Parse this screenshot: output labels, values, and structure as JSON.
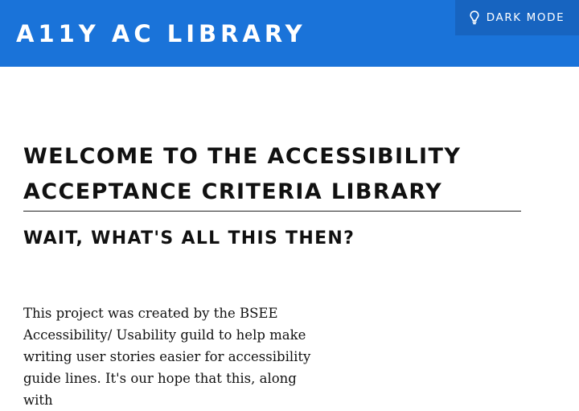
{
  "header": {
    "site_title": "A11Y AC LIBRARY",
    "dark_mode_label": "DARK MODE",
    "dark_mode_icon": "lightbulb-icon",
    "background_color": "#1a73d9",
    "toggle_background_color": "#1764c0"
  },
  "main": {
    "title": "WELCOME TO THE ACCESSIBILITY ACCEPTANCE CRITERIA LIBRARY",
    "subtitle": "WAIT, WHAT'S ALL THIS THEN?",
    "intro": "This project was created by the BSEE Accessibility/ Usability guild to help make writing user stories easier for accessibility guide lines. It's our hope that this, along with"
  }
}
